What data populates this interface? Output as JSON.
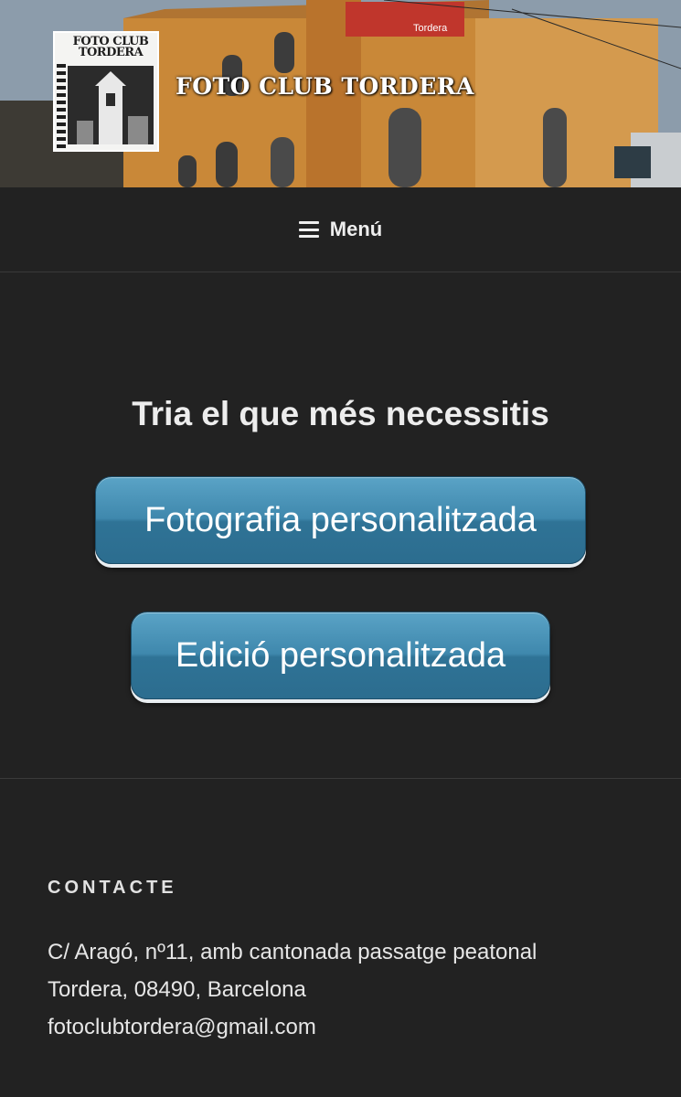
{
  "header": {
    "logo_text_line1": "FOTO CLUB",
    "logo_text_line2": "TORDERA",
    "site_title": "FOTO CLUB TORDERA",
    "station_sign": "Tordera"
  },
  "nav": {
    "menu_label": "Menú",
    "menu_icon": "hamburger-icon"
  },
  "main": {
    "title": "Tria el que més necessitis",
    "buttons": [
      {
        "label": "Fotografia personalitzada"
      },
      {
        "label": "Edició personalitzada"
      }
    ]
  },
  "footer": {
    "heading": "CONTACTE",
    "address_line1": "C/ Aragó, nº11, amb cantonada passatge peatonal",
    "address_line2": "Tordera, 08490, Barcelona",
    "email": "fotoclubtordera@gmail.com"
  },
  "colors": {
    "background": "#222222",
    "button_blue": "#3f88ad",
    "text": "#ededed"
  }
}
